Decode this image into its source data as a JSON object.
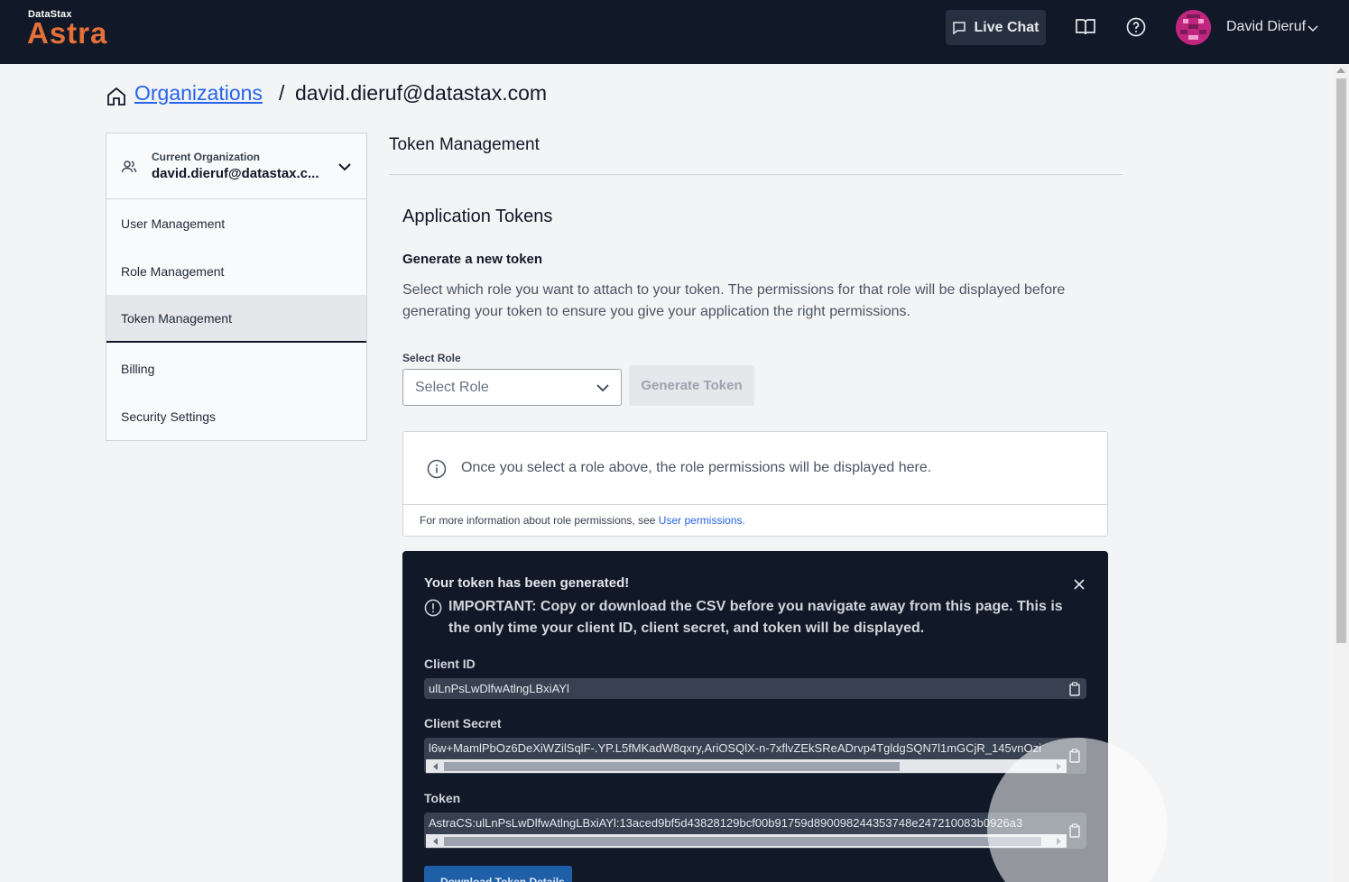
{
  "header": {
    "brand_small": "DataStax",
    "brand_big": "Astra",
    "live_chat_label": "Live Chat",
    "user_name": "David Dieruf"
  },
  "breadcrumb": {
    "link": "Organizations",
    "separator": "/",
    "current": "david.dieruf@datastax.com"
  },
  "sidebar": {
    "org_label": "Current Organization",
    "org_value": "david.dieruf@datastax.c...",
    "items": [
      {
        "label": "User Management"
      },
      {
        "label": "Role Management"
      },
      {
        "label": "Token Management"
      },
      {
        "label": "Billing"
      },
      {
        "label": "Security Settings"
      }
    ]
  },
  "main": {
    "title": "Token Management",
    "section_title": "Application Tokens",
    "sub_title": "Generate a new token",
    "description": "Select which role you want to attach to your token. The permissions for that role will be displayed before generating your token to ensure you give your application the right permissions.",
    "select_label": "Select Role",
    "select_placeholder": "Select Role",
    "generate_button": "Generate Token",
    "info_text": "Once you select a role above, the role permissions will be displayed here.",
    "info_footer_prefix": "For more information about role permissions, see",
    "info_footer_link": "User permissions."
  },
  "token_panel": {
    "title": "Your token has been generated!",
    "warning": "IMPORTANT: Copy or download the CSV before you navigate away from this page. This is the only time your client ID, client secret, and token will be displayed.",
    "client_id_label": "Client ID",
    "client_id_value": "ulLnPsLwDlfwAtlngLBxiAYl",
    "client_secret_label": "Client Secret",
    "client_secret_value": "l6w+MamlPbOz6DeXiWZilSqlF-.YP.L5fMKadW8qxry,AriOSQlX-n-7xflvZEkSReADrvp4TgldgSQN7l1mGCjR_145vnOzi",
    "token_label": "Token",
    "token_value": "AstraCS:ulLnPsLwDlfwAtlngLBxiAYl:13aced9bf5d43828129bcf00b91759d890098244353748e247210083b0926a3",
    "download_button": "Download Token Details"
  },
  "colors": {
    "topbar": "#111827",
    "brand": "#e4703a",
    "link": "#2563eb",
    "panel": "#111827"
  }
}
